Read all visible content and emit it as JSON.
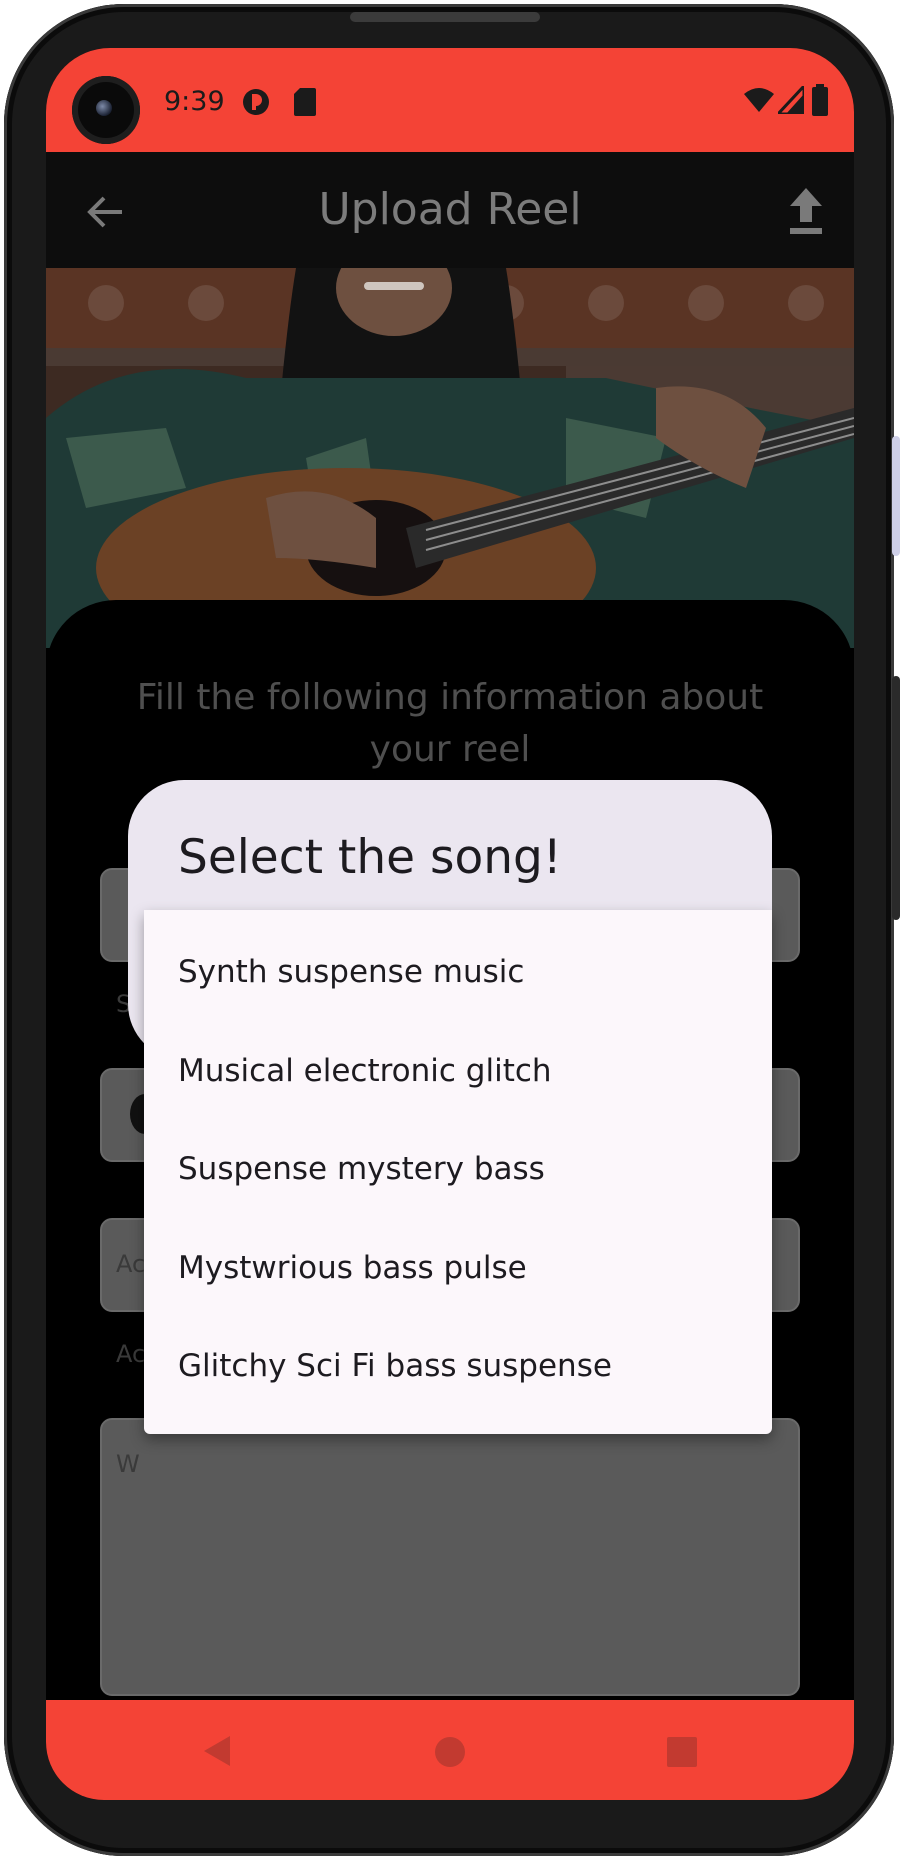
{
  "status_bar": {
    "time": "9:39",
    "color": "#f44336"
  },
  "app_bar": {
    "title": "Upload Reel",
    "back_icon": "arrow-back-icon",
    "upload_icon": "upload-icon"
  },
  "form": {
    "prompt": "Fill the following information about your reel",
    "partial_labels": [
      "S",
      "Ac",
      "Ac",
      "W"
    ]
  },
  "dialog": {
    "title": "Select the song!",
    "songs": [
      "Synth suspense music",
      "Musical electronic glitch",
      "Suspense mystery bass",
      "Mystwrious bass pulse",
      "Glitchy Sci Fi bass suspense"
    ]
  },
  "nav_bar": {
    "buttons": [
      "back-nav-icon",
      "home-nav-icon",
      "recents-nav-icon"
    ]
  }
}
